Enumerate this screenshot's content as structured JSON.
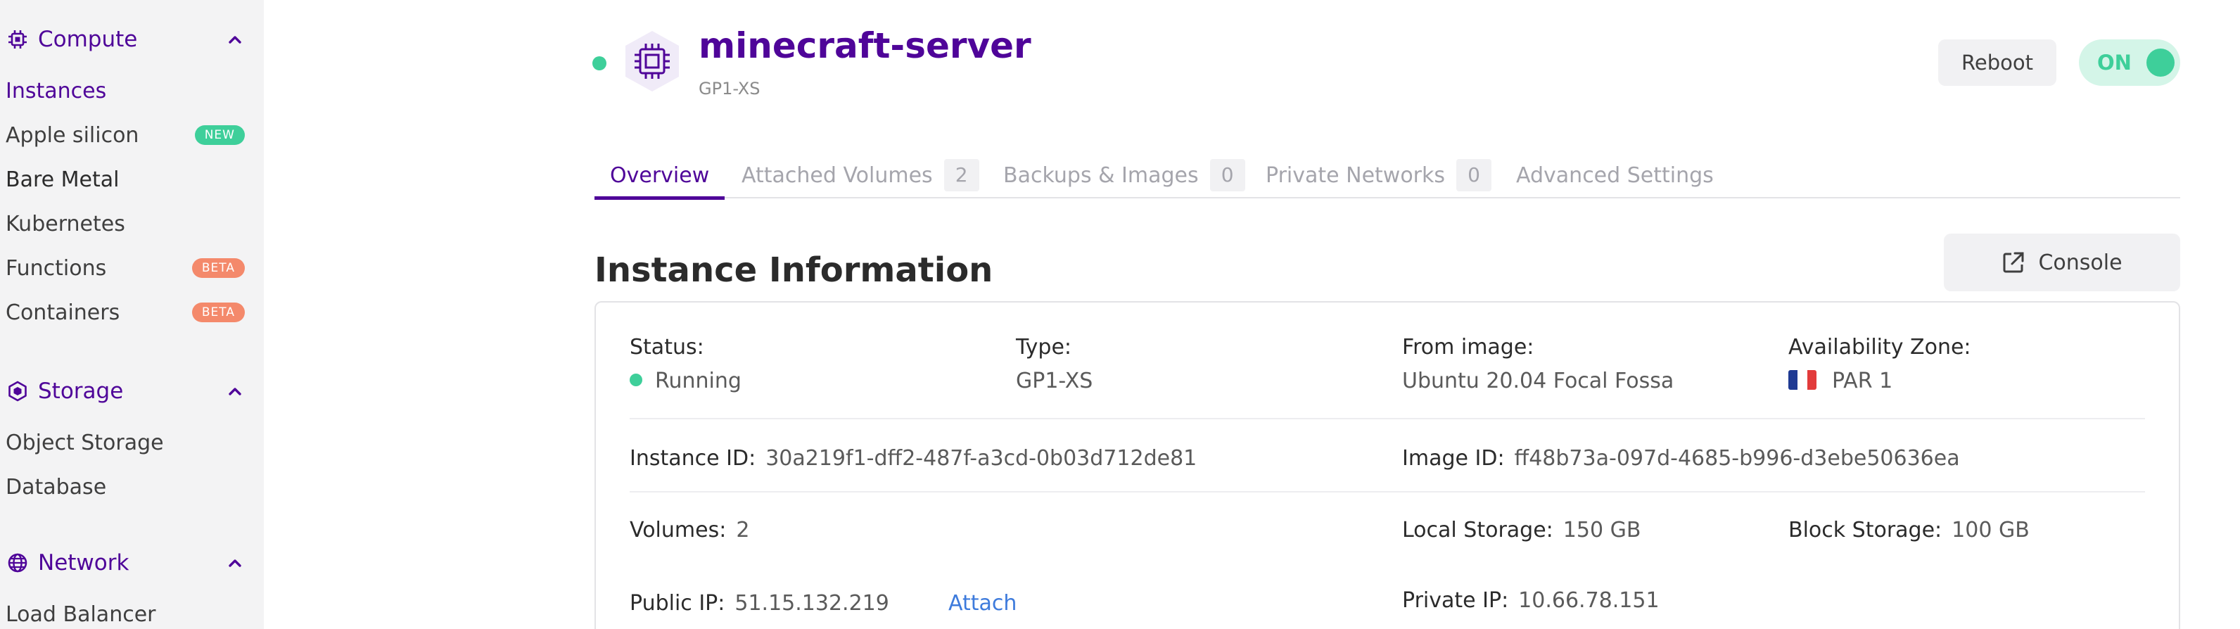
{
  "sidebar": {
    "sections": [
      {
        "label": "Compute",
        "icon": "chip-icon",
        "items": [
          {
            "label": "Instances",
            "badge": ""
          },
          {
            "label": "Apple silicon",
            "badge": "NEW"
          },
          {
            "label": "Bare Metal",
            "badge": ""
          },
          {
            "label": "Kubernetes",
            "badge": ""
          },
          {
            "label": "Functions",
            "badge": "BETA"
          },
          {
            "label": "Containers",
            "badge": "BETA"
          }
        ]
      },
      {
        "label": "Storage",
        "icon": "hexagon-icon",
        "items": [
          {
            "label": "Object Storage"
          },
          {
            "label": "Database"
          }
        ]
      },
      {
        "label": "Network",
        "icon": "globe-icon",
        "items": [
          {
            "label": "Load Balancer"
          }
        ]
      }
    ]
  },
  "header": {
    "name": "minecraft-server",
    "type": "GP1-XS",
    "reboot_label": "Reboot",
    "toggle_label": "ON"
  },
  "tabs": [
    {
      "label": "Overview",
      "count": ""
    },
    {
      "label": "Attached Volumes",
      "count": "2"
    },
    {
      "label": "Backups & Images",
      "count": "0"
    },
    {
      "label": "Private Networks",
      "count": "0"
    },
    {
      "label": "Advanced Settings",
      "count": ""
    }
  ],
  "info": {
    "title": "Instance Information",
    "console_label": "Console",
    "status_label": "Status:",
    "status_value": "Running",
    "type_label": "Type:",
    "type_value": "GP1-XS",
    "image_label": "From image:",
    "image_value": "Ubuntu 20.04 Focal Fossa",
    "zone_label": "Availability Zone:",
    "zone_value": "PAR 1",
    "instance_id_label": "Instance ID:",
    "instance_id_value": "30a219f1-dff2-487f-a3cd-0b03d712de81",
    "image_id_label": "Image ID:",
    "image_id_value": "ff48b73a-097d-4685-b996-d3ebe50636ea",
    "volumes_label": "Volumes:",
    "volumes_value": "2",
    "local_storage_label": "Local Storage:",
    "local_storage_value": "150 GB",
    "block_storage_label": "Block Storage:",
    "block_storage_value": "100 GB",
    "public_ip_label": "Public IP:",
    "public_ip_value": "51.15.132.219",
    "attach_label": "Attach",
    "private_ip_label": "Private IP:",
    "private_ip_value": "10.66.78.151"
  },
  "colors": {
    "brand": "#4f0599",
    "success": "#3ecf9a",
    "new_badge": "#3ecf9a",
    "beta_badge": "#f4896b",
    "link": "#3e7bdc"
  }
}
